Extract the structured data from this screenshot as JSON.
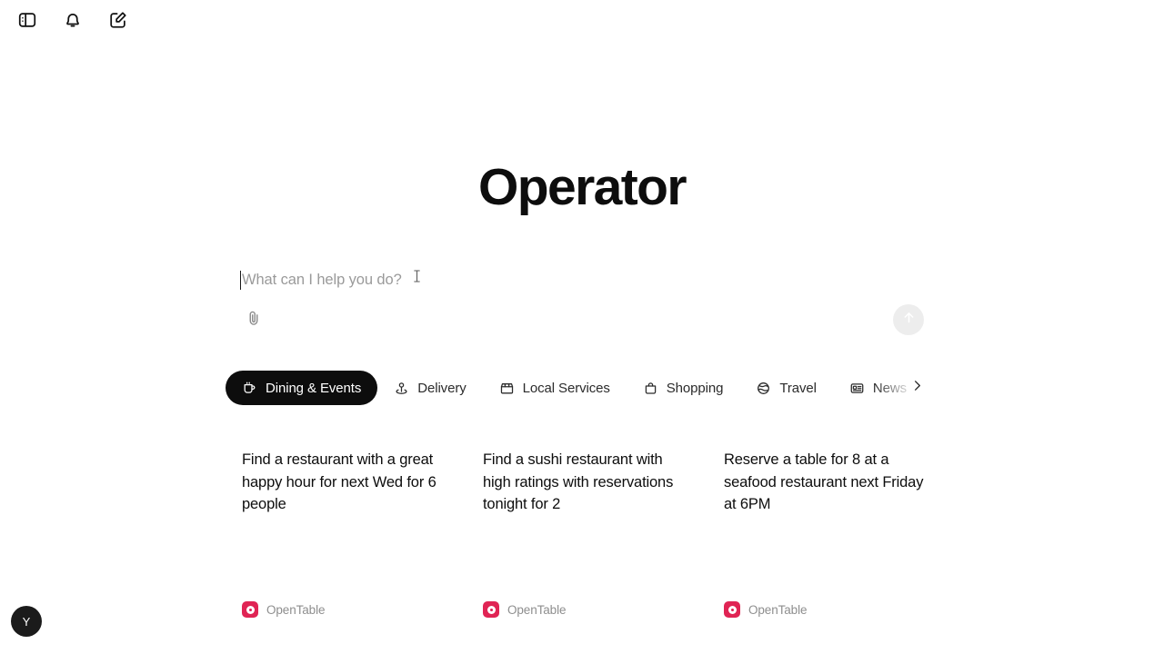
{
  "app": {
    "title": "Operator"
  },
  "topbar": {
    "sidebar_toggle": "sidebar-toggle-icon",
    "notifications": "bell-icon",
    "new_chat": "compose-icon"
  },
  "composer": {
    "placeholder": "What can I help you do?",
    "value": "",
    "attach_icon": "paperclip-icon",
    "send_icon": "arrow-up-icon"
  },
  "categories": {
    "next_icon": "chevron-right-icon",
    "items": [
      {
        "label": "Dining & Events",
        "icon": "cup-icon",
        "active": true
      },
      {
        "label": "Delivery",
        "icon": "location-pin-icon",
        "active": false
      },
      {
        "label": "Local Services",
        "icon": "storefront-icon",
        "active": false
      },
      {
        "label": "Shopping",
        "icon": "shopping-bag-icon",
        "active": false
      },
      {
        "label": "Travel",
        "icon": "globe-icon",
        "active": false
      },
      {
        "label": "News",
        "icon": "news-card-icon",
        "active": false
      }
    ]
  },
  "suggestions": [
    {
      "prompt": "Find a restaurant with a great happy hour for next Wed for 6 people",
      "source": "OpenTable",
      "source_color": "#e02454"
    },
    {
      "prompt": "Find a sushi restaurant with high ratings with reservations tonight for 2",
      "source": "OpenTable",
      "source_color": "#e02454"
    },
    {
      "prompt": "Reserve a table for 8 at a seafood restaurant next Friday at 6PM",
      "source": "OpenTable",
      "source_color": "#e02454"
    }
  ],
  "user": {
    "avatar_initial": "Y"
  }
}
